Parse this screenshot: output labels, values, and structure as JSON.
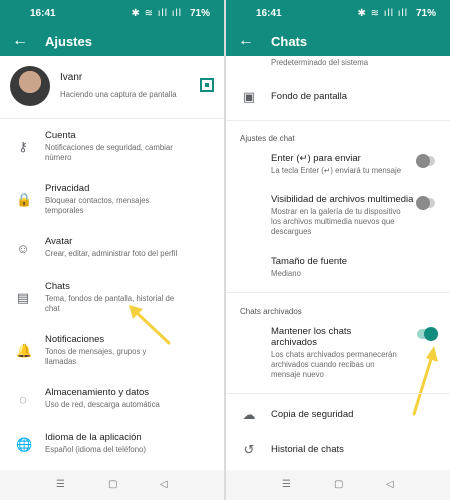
{
  "left": {
    "status": {
      "time": "16:41",
      "icons": "✱ ≋ ıll ıll",
      "battery": "71%"
    },
    "appbar": {
      "title": "Ajustes"
    },
    "profile": {
      "name": "Ivanr",
      "status": "Haciendo una captura de pantalla"
    },
    "items": [
      {
        "title": "Cuenta",
        "subtitle": "Notificaciones de seguridad, cambiar número"
      },
      {
        "title": "Privacidad",
        "subtitle": "Bloquear contactos, mensajes temporales"
      },
      {
        "title": "Avatar",
        "subtitle": "Crear, editar, administrar foto del perfil"
      },
      {
        "title": "Chats",
        "subtitle": "Tema, fondos de pantalla, historial de chat"
      },
      {
        "title": "Notificaciones",
        "subtitle": "Tonos de mensajes, grupos y llamadas"
      },
      {
        "title": "Almacenamiento y datos",
        "subtitle": "Uso de red, descarga automática"
      },
      {
        "title": "Idioma de la aplicación",
        "subtitle": "Español (idioma del teléfono)"
      }
    ]
  },
  "right": {
    "status": {
      "time": "16:41",
      "icons": "✱ ≋ ıll ıll",
      "battery": "71%"
    },
    "appbar": {
      "title": "Chats"
    },
    "top_subtitle": "Predeterminado del sistema",
    "wallpaper": "Fondo de pantalla",
    "section_settings": "Ajustes de chat",
    "enter": {
      "title": "Enter (↵) para enviar",
      "subtitle": "La tecla Enter (↵) enviará tu mensaje"
    },
    "media": {
      "title": "Visibilidad de archivos multimedia",
      "subtitle": "Mostrar en la galería de tu dispositivo los archivos multimedia nuevos que descargues"
    },
    "font": {
      "title": "Tamaño de fuente",
      "subtitle": "Mediano"
    },
    "section_archived": "Chats archivados",
    "keep": {
      "title": "Mantener los chats archivados",
      "subtitle": "Los chats archivados permanecerán archivados cuando recibas un mensaje nuevo"
    },
    "backup": "Copia de seguridad",
    "history": "Historial de chats"
  },
  "nav": {
    "menu": "☰",
    "home": "▢",
    "back": "◁"
  },
  "colors": {
    "primary": "#128C7E",
    "arrow": "#F4D03F"
  },
  "toggles": {
    "enter": false,
    "media": false,
    "keep": true
  }
}
